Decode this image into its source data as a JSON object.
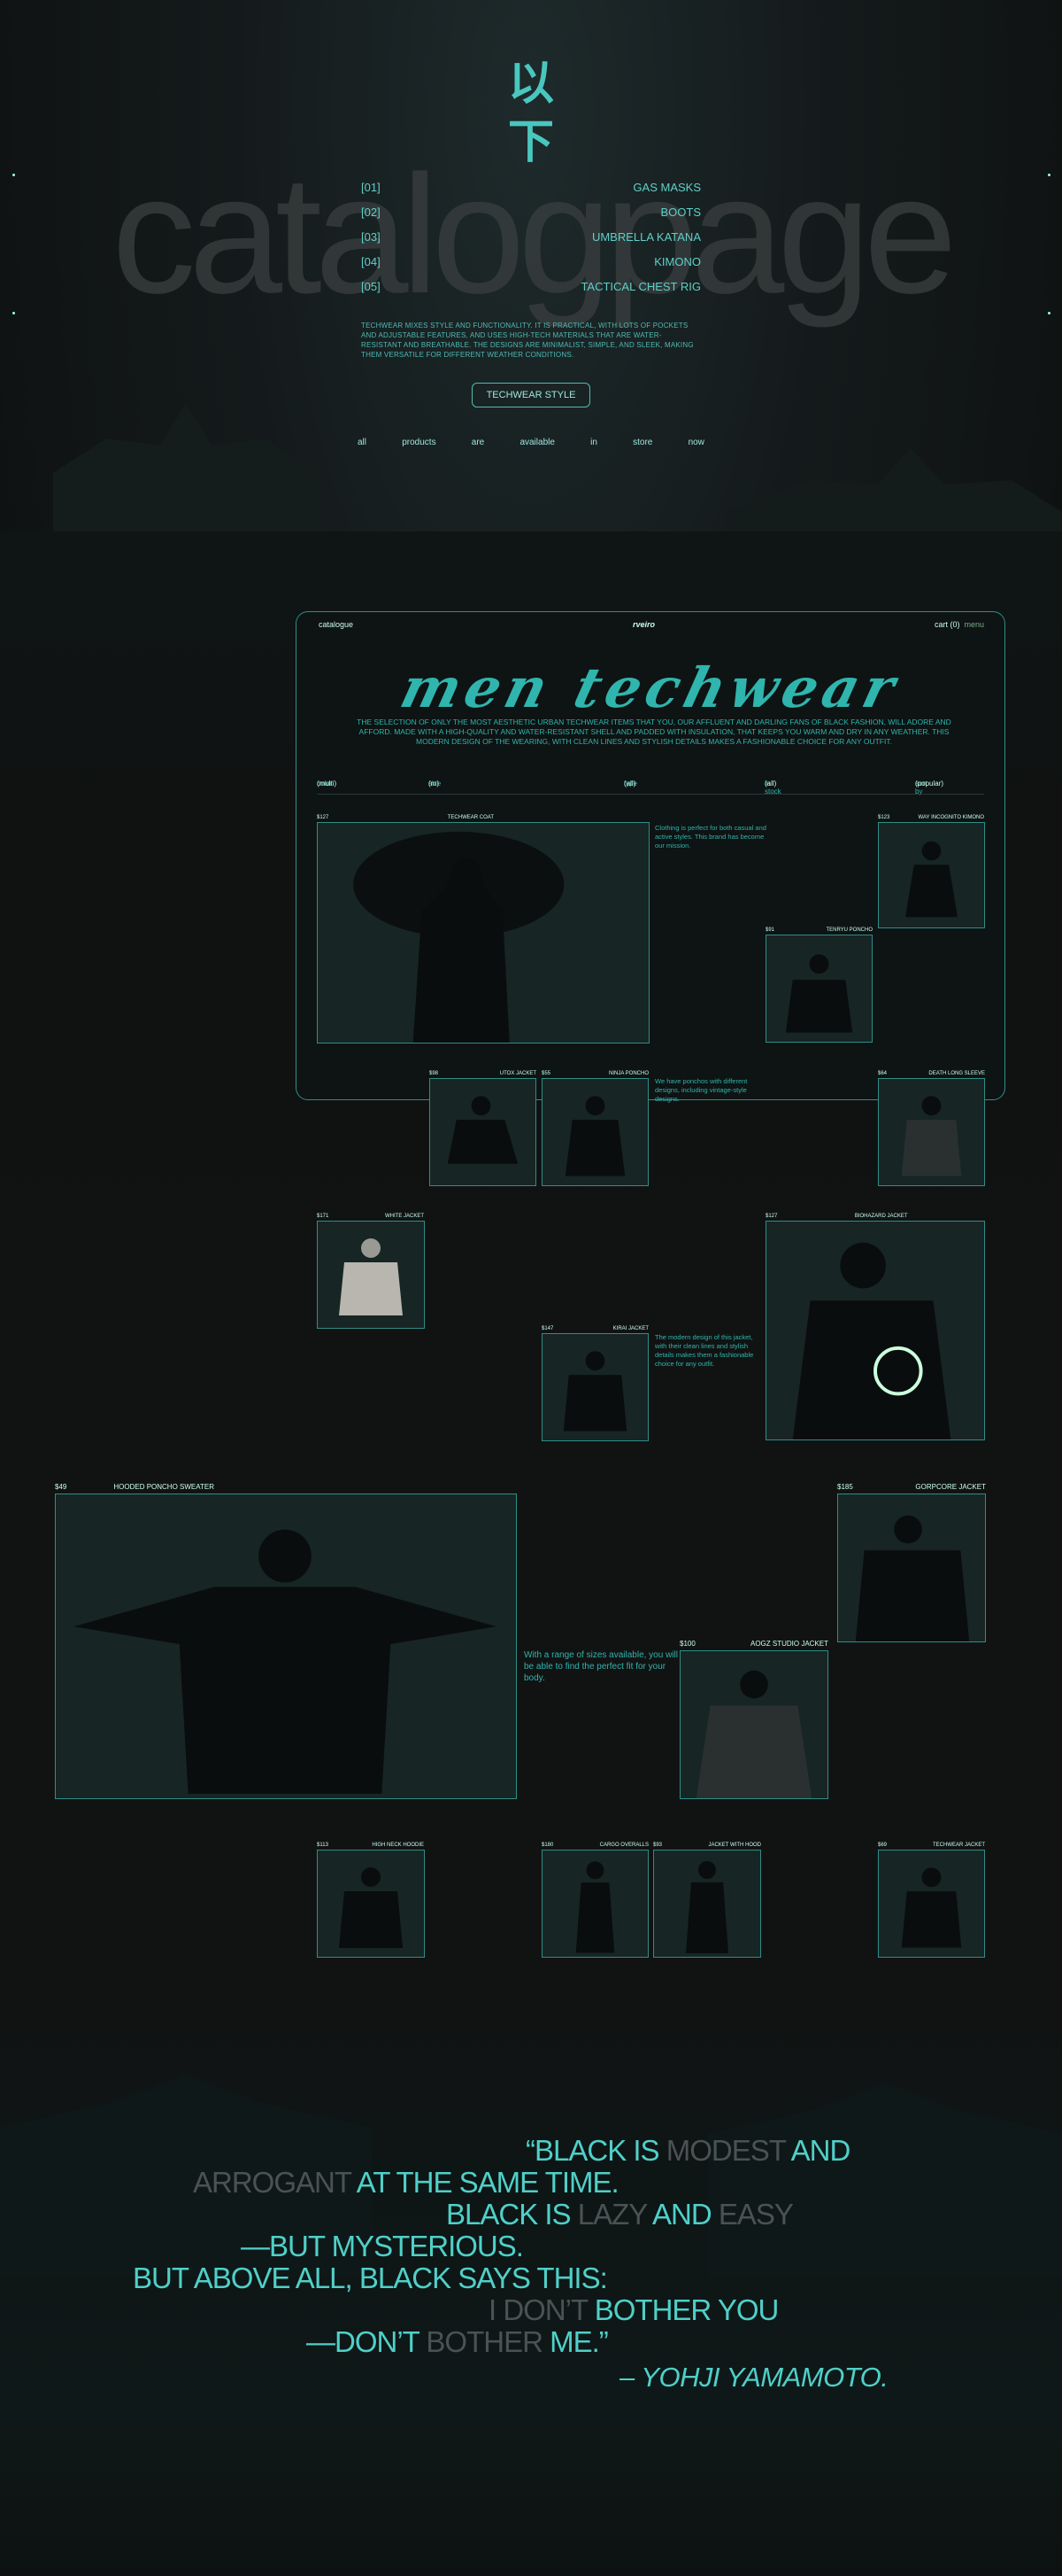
{
  "hero": {
    "cjk_top": "以",
    "cjk_bottom": "下",
    "big_word": "catalogpage",
    "menu": [
      {
        "num": "[01]",
        "label": "GAS MASKS"
      },
      {
        "num": "[02]",
        "label": "BOOTS"
      },
      {
        "num": "[03]",
        "label": "UMBRELLA KATANA"
      },
      {
        "num": "[04]",
        "label": "KIMONO"
      },
      {
        "num": "[05]",
        "label": "TACTICAL CHEST RIG"
      }
    ],
    "intro": "TECHWEAR MIXES STYLE AND FUNCTIONALITY. IT IS PRACTICAL, WITH LOTS OF POCKETS AND ADJUSTABLE FEATURES, AND USES HIGH-TECH MATERIALS THAT ARE WATER-RESISTANT AND BREATHABLE. THE DESIGNS ARE MINIMALIST, SIMPLE, AND SLEEK, MAKING THEM VERSATILE FOR DIFFERENT WEATHER CONDITIONS.",
    "style_button": "TECHWEAR STYLE",
    "tagline_words": [
      "all",
      "products",
      "are",
      "available",
      "in",
      "store",
      "now"
    ]
  },
  "catalog": {
    "nav_left": "catalogue",
    "logo": "rveiro",
    "nav_right": "cart (0)",
    "nav_menu": "menu",
    "title": "men techwear",
    "description": "THE SELECTION OF ONLY THE MOST AESTHETIC URBAN TECHWEAR ITEMS THAT YOU, OUR AFFLUENT AND DARLING FANS OF BLACK FASHION, WILL ADORE AND AFFORD. MADE WITH A HIGH-QUALITY AND WATER-RESISTANT SHELL AND PADDED WITH INSULATION, THAT KEEPS YOU WARM AND DRY IN ANY WEATHER. THIS MODERN DESIGN OF THE WEARING, WITH CLEAN LINES AND STYLISH DETAILS MAKES A FASHIONABLE CHOICE FOR ANY OUTFIT.",
    "filters": [
      {
        "key": "color",
        "value": "(multi)"
      },
      {
        "key": "size",
        "value": "(m)"
      },
      {
        "key": "type",
        "value": "(all)"
      },
      {
        "key": "in stock",
        "value": "(all)"
      },
      {
        "key": "sort by",
        "value": "(popular)"
      }
    ]
  },
  "products": [
    {
      "price": "$127",
      "name": "TECHWEAR COAT"
    },
    {
      "price": "$123",
      "name": "WAY INCOGNITO KIMONO"
    },
    {
      "price": "$91",
      "name": "TENRYU PONCHO"
    },
    {
      "price": "$98",
      "name": "UTOX JACKET"
    },
    {
      "price": "$55",
      "name": "NINJA PONCHO"
    },
    {
      "price": "$64",
      "name": "DEATH LONG SLEEVE"
    },
    {
      "price": "$171",
      "name": "WHITE JACKET"
    },
    {
      "price": "$127",
      "name": "BIOHAZARD JACKET"
    },
    {
      "price": "$147",
      "name": "KIRAI JACKET"
    },
    {
      "price": "$49",
      "name": "HOODED PONCHO SWEATER"
    },
    {
      "price": "$185",
      "name": "GORPCORE JACKET"
    },
    {
      "price": "$100",
      "name": "AOGZ STUDIO JACKET"
    },
    {
      "price": "$113",
      "name": "HIGH NECK HOODIE"
    },
    {
      "price": "$180",
      "name": "CARGO OVERALLS"
    },
    {
      "price": "$93",
      "name": "JACKET WITH HOOD"
    },
    {
      "price": "$69",
      "name": "TECHWEAR JACKET"
    }
  ],
  "notes": {
    "note1": "Clothing is perfect for both casual and active styles. This brand has become our mission.",
    "note2": "We have ponchos with different designs, including vintage-style designs.",
    "note3": "The modern design of this jacket, with their clean lines and stylish details makes them a fashionable choice for any outfit.",
    "note4": "With a range of sizes available, you will be able to find the perfect fit for your body."
  },
  "quote": {
    "lines": [
      [
        {
          "t": "“BLACK IS ",
          "g": false
        },
        {
          "t": "MODEST",
          "g": true
        },
        {
          "t": " AND",
          "g": false
        }
      ],
      [
        {
          "t": "ARROGANT",
          "g": true
        },
        {
          "t": " AT THE SAME TIME.",
          "g": false
        }
      ],
      [
        {
          "t": "BLACK IS ",
          "g": false
        },
        {
          "t": "LAZY",
          "g": true
        },
        {
          "t": " AND ",
          "g": false
        },
        {
          "t": "EASY",
          "g": true
        }
      ],
      [
        {
          "t": "—BUT MYSTERIOUS.",
          "g": false
        }
      ],
      [
        {
          "t": "BUT ABOVE ALL, BLACK SAYS THIS:",
          "g": false
        }
      ],
      [
        {
          "t": "I DON’T",
          "g": true
        },
        {
          "t": " BOTHER YOU",
          "g": false
        }
      ],
      [
        {
          "t": "—DON’T ",
          "g": false
        },
        {
          "t": "BOTHER",
          "g": true
        },
        {
          "t": " ME.”",
          "g": false
        }
      ]
    ],
    "author": "– YOHJI YAMAMOTO."
  },
  "colors": {
    "accent": "#4fd0c8",
    "background": "#111313",
    "muted": "#4b5253"
  }
}
